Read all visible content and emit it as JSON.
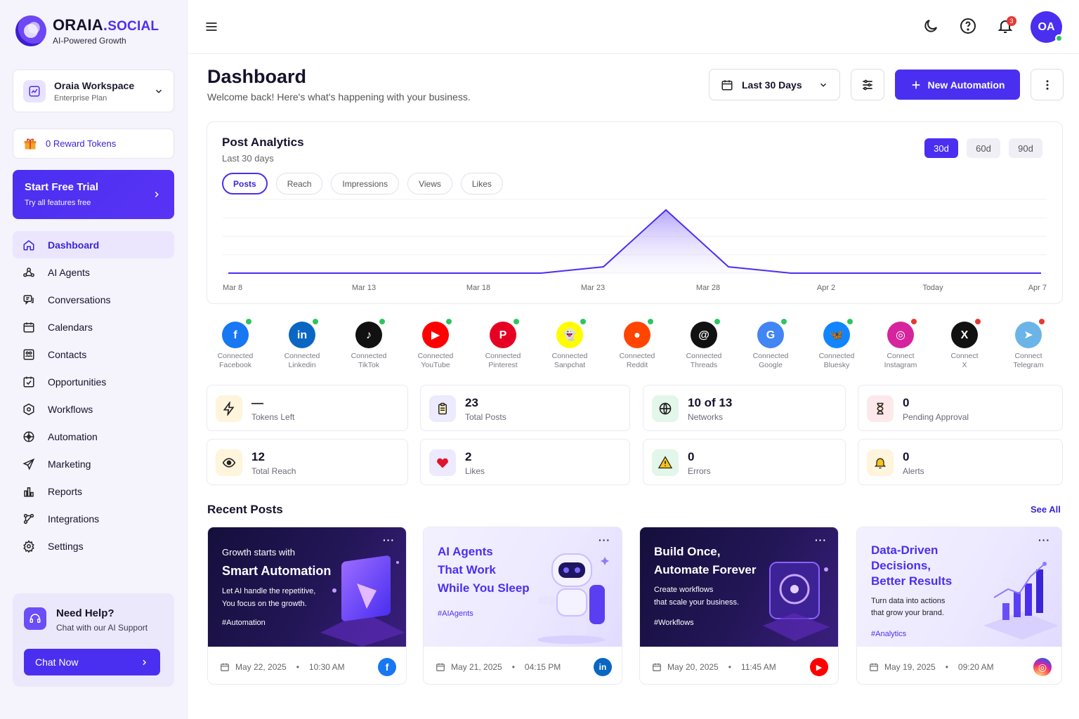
{
  "brand": {
    "name_main": "ORAIA",
    "name_dot": ".",
    "name_suffix": "SOCIAL",
    "tagline": "AI-Powered Growth"
  },
  "workspace": {
    "name": "Oraia Workspace",
    "plan": "Enterprise Plan"
  },
  "reward": {
    "label": "0 Reward Tokens"
  },
  "trial": {
    "title": "Start Free Trial",
    "subtitle": "Try all features free"
  },
  "nav": [
    {
      "label": "Dashboard",
      "icon": "home-icon",
      "active": true
    },
    {
      "label": "AI Agents",
      "icon": "agents-icon"
    },
    {
      "label": "Conversations",
      "icon": "chat-icon"
    },
    {
      "label": "Calendars",
      "icon": "calendar-icon"
    },
    {
      "label": "Contacts",
      "icon": "contacts-icon"
    },
    {
      "label": "Opportunities",
      "icon": "opportunities-icon"
    },
    {
      "label": "Workflows",
      "icon": "workflows-icon"
    },
    {
      "label": "Automation",
      "icon": "automation-icon"
    },
    {
      "label": "Marketing",
      "icon": "send-icon"
    },
    {
      "label": "Reports",
      "icon": "reports-icon"
    },
    {
      "label": "Integrations",
      "icon": "integrations-icon"
    },
    {
      "label": "Settings",
      "icon": "gear-icon"
    }
  ],
  "help": {
    "title": "Need Help?",
    "subtitle": "Chat with our AI Support",
    "button": "Chat Now"
  },
  "topbar": {
    "notifications": "3",
    "avatar": "OA"
  },
  "page": {
    "title": "Dashboard",
    "subtitle": "Welcome back! Here's what's happening with your business.",
    "date_range": "Last 30 Days",
    "new_button": "New Automation"
  },
  "analytics": {
    "title": "Post Analytics",
    "subtitle": "Last 30 days",
    "periods": [
      "30d",
      "60d",
      "90d"
    ],
    "active_period": "30d",
    "metrics": [
      "Posts",
      "Reach",
      "Impressions",
      "Views",
      "Likes"
    ],
    "active_metric": "Posts"
  },
  "chart_data": {
    "type": "area",
    "x_labels": [
      "Mar 8",
      "Mar 13",
      "Mar 18",
      "Mar 23",
      "Mar 28",
      "Apr 2",
      "Today",
      "Apr 7"
    ],
    "series": [
      {
        "values": [
          0,
          0,
          0,
          0,
          0,
          0,
          0.1,
          1,
          0.1,
          0,
          0,
          0,
          0,
          0
        ]
      }
    ],
    "grid": true,
    "accent": "#4a2ff0"
  },
  "networks": [
    {
      "status": "Connected",
      "name": "Facebook",
      "color": "#1877f2",
      "glyph": "f",
      "ok": true
    },
    {
      "status": "Connected",
      "name": "Linkedin",
      "color": "#0a66c2",
      "glyph": "in",
      "ok": true
    },
    {
      "status": "Connected",
      "name": "TikTok",
      "color": "#111111",
      "glyph": "♪",
      "ok": true
    },
    {
      "status": "Connected",
      "name": "YouTube",
      "color": "#ff0000",
      "glyph": "▶",
      "ok": true
    },
    {
      "status": "Connected",
      "name": "Pinterest",
      "color": "#e60023",
      "glyph": "P",
      "ok": true
    },
    {
      "status": "Connected",
      "name": "Sanpchat",
      "color": "#fffc00",
      "glyph": "👻",
      "ok": true
    },
    {
      "status": "Connected",
      "name": "Reddit",
      "color": "#ff4500",
      "glyph": "●",
      "ok": true
    },
    {
      "status": "Connected",
      "name": "Threads",
      "color": "#111111",
      "glyph": "@",
      "ok": true
    },
    {
      "status": "Connected",
      "name": "Google",
      "color": "#4285f4",
      "glyph": "G",
      "ok": true
    },
    {
      "status": "Connected",
      "name": "Bluesky",
      "color": "#1185fe",
      "glyph": "🦋",
      "ok": true
    },
    {
      "status": "Connect",
      "name": "Instagram",
      "color": "#d6249f",
      "glyph": "◎",
      "ok": false
    },
    {
      "status": "Connect",
      "name": "X",
      "color": "#111111",
      "glyph": "X",
      "ok": false
    },
    {
      "status": "Connect",
      "name": "Telegram",
      "color": "#6ab4e8",
      "glyph": "➤",
      "ok": false
    }
  ],
  "stats": [
    {
      "value": "—",
      "label": "Tokens Left",
      "icon": "bolt-icon",
      "bg": "#fff4dc"
    },
    {
      "value": "23",
      "label": "Total Posts",
      "icon": "clipboard-icon",
      "bg": "#eceafd"
    },
    {
      "value": "10 of 13",
      "label": "Networks",
      "icon": "globe-icon",
      "bg": "#e2f6ea"
    },
    {
      "value": "0",
      "label": "Pending Approval",
      "icon": "hourglass-icon",
      "bg": "#fde9ec"
    },
    {
      "value": "12",
      "label": "Total Reach",
      "icon": "eye-icon",
      "bg": "#fff4dc"
    },
    {
      "value": "2",
      "label": "Likes",
      "icon": "heart-icon",
      "bg": "#eceafd"
    },
    {
      "value": "0",
      "label": "Errors",
      "icon": "warning-icon",
      "bg": "#e2f6ea"
    },
    {
      "value": "0",
      "label": "Alerts",
      "icon": "bell-icon",
      "bg": "#fff4dc"
    }
  ],
  "recent": {
    "title": "Recent Posts",
    "see_all": "See All",
    "posts": [
      {
        "kicker": "Growth starts with",
        "headline": "Smart Automation",
        "body1": "Let AI handle the repetitive,",
        "body2": "You focus on the growth.",
        "tag": "#Automation",
        "date": "May 22, 2025",
        "time": "10:30 AM",
        "network": "facebook-icon"
      },
      {
        "headline1": "AI Agents",
        "headline2": "That Work",
        "headline3": "While You Sleep",
        "tag": "#AIAgents",
        "date": "May 21, 2025",
        "time": "04:15 PM",
        "network": "linkedin-icon"
      },
      {
        "headline1": "Build Once,",
        "headline2": "Automate Forever",
        "body1": "Create workflows",
        "body2": "that scale your business.",
        "tag": "#Workflows",
        "date": "May 20, 2025",
        "time": "11:45 AM",
        "network": "youtube-icon"
      },
      {
        "headline1": "Data-Driven",
        "headline2": "Decisions,",
        "headline3": "Better Results",
        "body1": "Turn data into actions",
        "body2": "that grow your brand.",
        "tag": "#Analytics",
        "date": "May 19, 2025",
        "time": "09:20 AM",
        "network": "instagram-icon"
      }
    ]
  }
}
